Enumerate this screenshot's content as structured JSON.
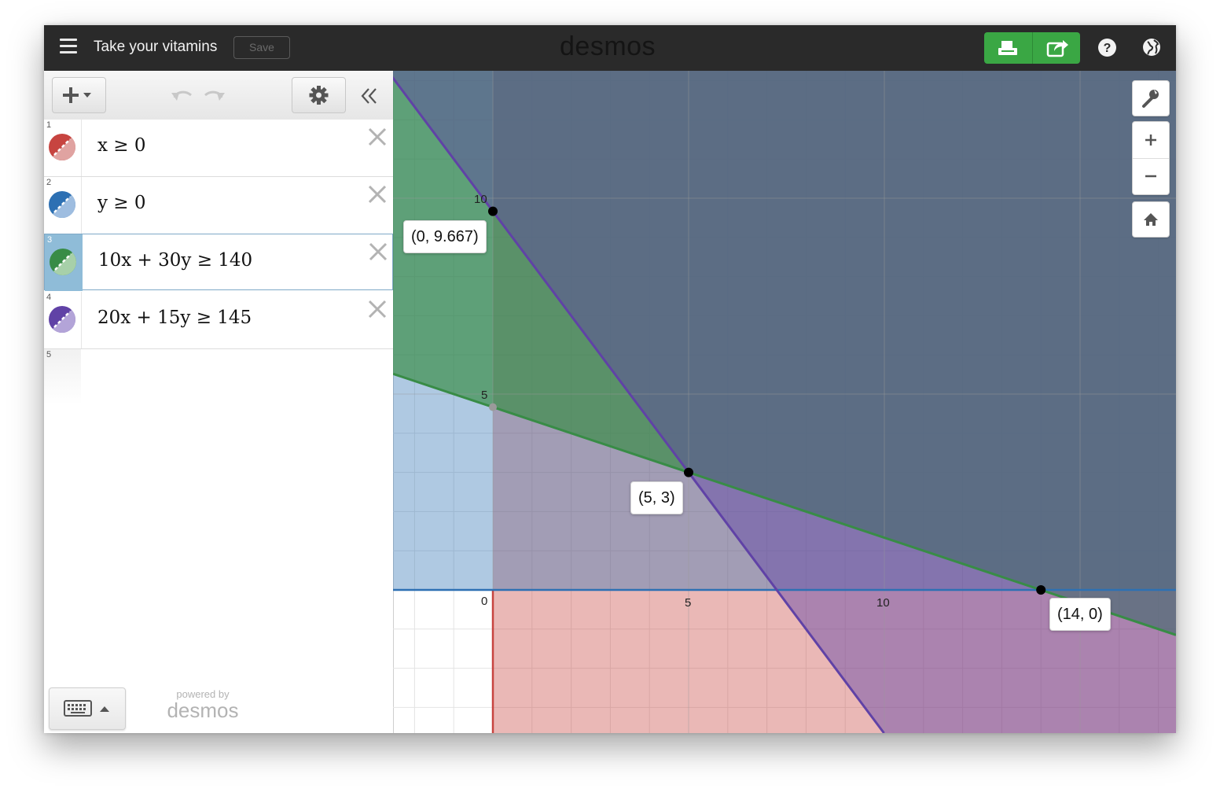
{
  "header": {
    "title": "Take your vitamins",
    "save_label": "Save",
    "brand": "desmos",
    "icons": [
      "hamburger-icon",
      "print-icon",
      "share-icon",
      "help-icon",
      "globe-icon"
    ],
    "accent_color": "#3aa744"
  },
  "expressions": [
    {
      "index": "1",
      "latex": "x ≥ 0",
      "color": "#c74440"
    },
    {
      "index": "2",
      "latex": "y ≥ 0",
      "color": "#2d70b3"
    },
    {
      "index": "3",
      "latex": "10x + 30y ≥ 140",
      "color": "#388c46"
    },
    {
      "index": "4",
      "latex": "20x + 15y ≥ 145",
      "color": "#6042a6"
    },
    {
      "index": "5",
      "latex": ""
    }
  ],
  "footer": {
    "powered_by": "powered by",
    "brand": "desmos",
    "keypad_icon": "keyboard-icon"
  },
  "graph": {
    "ticks": {
      "origin": "0",
      "x5": "5",
      "x10": "10",
      "y5": "5",
      "y10": "10"
    },
    "points": [
      {
        "label": "(0, 9.667)",
        "x": 0,
        "y": 9.667
      },
      {
        "label": "(5, 3)",
        "x": 5,
        "y": 3
      },
      {
        "label": "(14, 0)",
        "x": 14,
        "y": 0
      }
    ],
    "controls": [
      "wrench-icon",
      "zoom-in-icon",
      "zoom-out-icon",
      "home-icon"
    ]
  }
}
